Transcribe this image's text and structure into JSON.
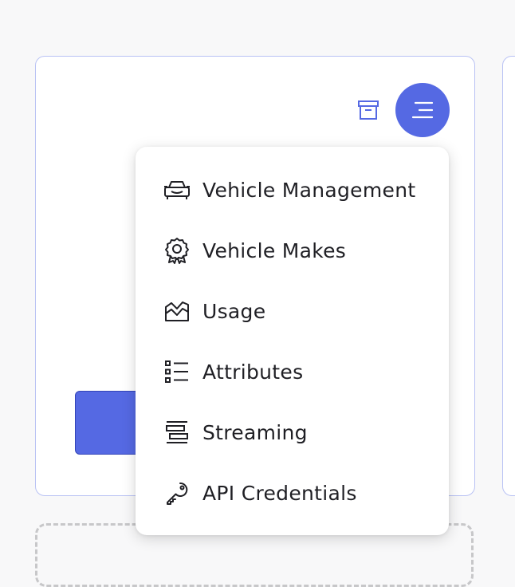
{
  "colors": {
    "accent": "#5569e3",
    "card_border": "#b9c2f4",
    "text": "#1f1f24"
  },
  "toolbar": {
    "archive_icon": "archive-icon",
    "menu_icon": "menu-lines-icon"
  },
  "menu": {
    "items": [
      {
        "label": "Vehicle Management",
        "icon": "car-icon"
      },
      {
        "label": "Vehicle Makes",
        "icon": "badge-award-icon"
      },
      {
        "label": "Usage",
        "icon": "area-chart-icon"
      },
      {
        "label": "Attributes",
        "icon": "checklist-icon"
      },
      {
        "label": "Streaming",
        "icon": "stacked-bars-icon"
      },
      {
        "label": "API Credentials",
        "icon": "key-icon"
      }
    ]
  }
}
